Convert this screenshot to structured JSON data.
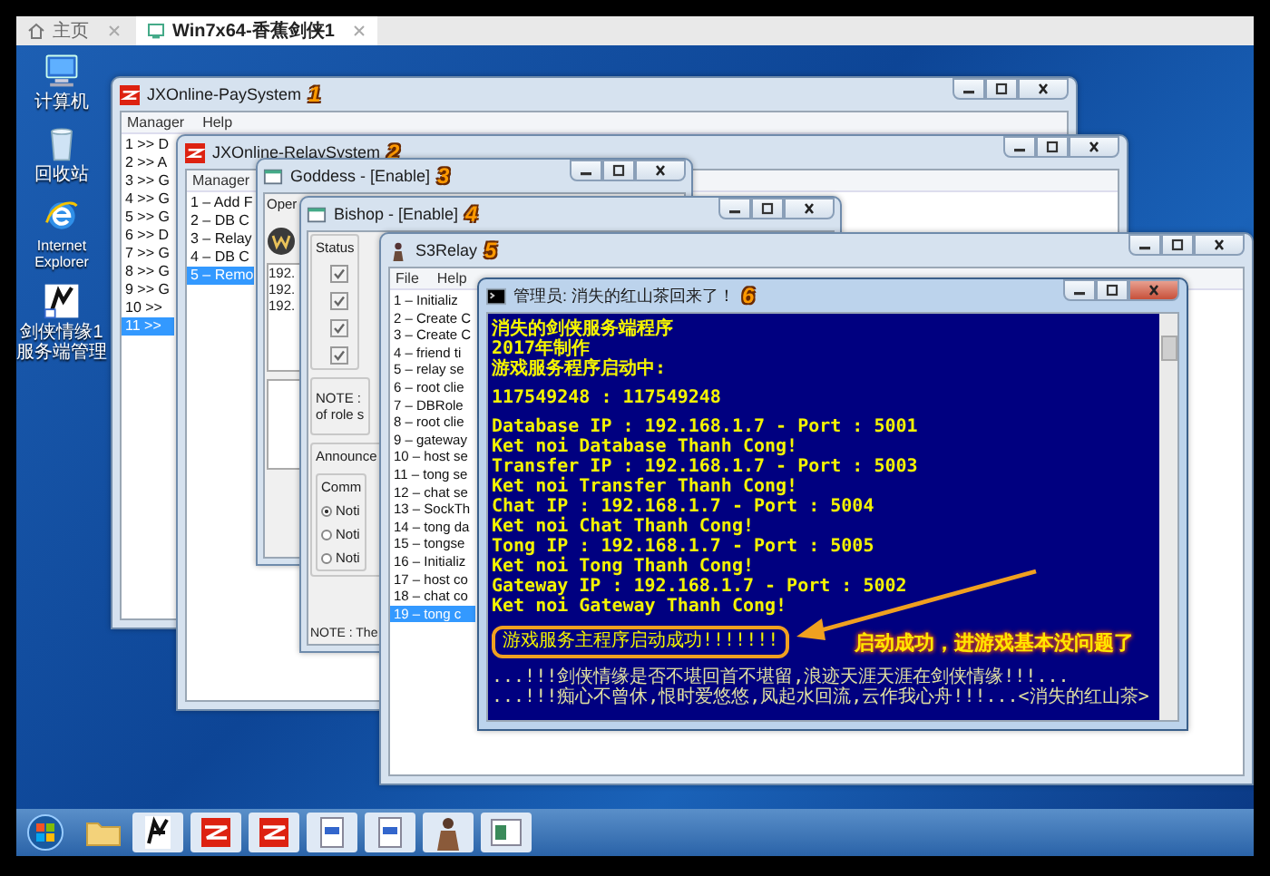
{
  "browser_tabs": [
    {
      "label": "主页",
      "selected": false
    },
    {
      "label": "Win7x64-香蕉剑侠1",
      "selected": true
    }
  ],
  "desktop_icons": [
    {
      "label": "计算机",
      "kind": "computer"
    },
    {
      "label": "回收站",
      "kind": "bin"
    },
    {
      "label": "Internet Explorer",
      "kind": "browser"
    },
    {
      "label": "剑侠情缘1服务端管理",
      "kind": "game"
    }
  ],
  "windows": [
    {
      "kind": "pay",
      "title": "JXOnline-PaySystem",
      "badge": "1",
      "active": false,
      "menu": [
        "Manager",
        "Help"
      ],
      "items": [
        {
          "text": "1 >> D",
          "selected": false
        },
        {
          "text": "2 >> A",
          "selected": false
        },
        {
          "text": "3 >> G",
          "selected": false
        },
        {
          "text": "4 >> G",
          "selected": false
        },
        {
          "text": "5 >> G",
          "selected": false
        },
        {
          "text": "6 >> D",
          "selected": false
        },
        {
          "text": "7 >> G",
          "selected": false
        },
        {
          "text": "8 >> G",
          "selected": false
        },
        {
          "text": "9 >> G",
          "selected": false
        },
        {
          "text": "10 >>",
          "selected": false
        },
        {
          "text": "11 >>",
          "selected": true
        }
      ]
    },
    {
      "kind": "relay",
      "title": "JXOnline-RelaySystem",
      "badge": "2",
      "active": false,
      "menu": [
        "Manager"
      ],
      "items": [
        {
          "text": "1 – Add F",
          "selected": false
        },
        {
          "text": "2 – DB C",
          "selected": false
        },
        {
          "text": "3 – Relay",
          "selected": false
        },
        {
          "text": "4 – DB C",
          "selected": false
        },
        {
          "text": "5 – Remo",
          "selected": true
        }
      ]
    },
    {
      "kind": "goddess",
      "title": "Goddess - [Enable]",
      "badge": "3",
      "active": false,
      "label": "Oper",
      "lines": [
        "192.",
        "192.",
        "192."
      ]
    },
    {
      "kind": "bishop",
      "title": "Bishop - [Enable]",
      "badge": "4",
      "active": false,
      "status_label": "Status",
      "checks": [
        {
          "checked": true
        },
        {
          "checked": true
        },
        {
          "checked": true
        },
        {
          "checked": true
        }
      ],
      "note_lines": [
        "NOTE :",
        "of role s"
      ],
      "group_label": "Announce",
      "subgroup_label": "Comm",
      "radios": [
        {
          "label": "Noti",
          "selected": true
        },
        {
          "label": "Noti",
          "selected": false
        },
        {
          "label": "Noti",
          "selected": false
        }
      ],
      "footer": "NOTE : The"
    },
    {
      "kind": "s3relay",
      "title": "S3Relay",
      "badge": "5",
      "active": false,
      "menu": [
        "File",
        "Help"
      ],
      "items": [
        {
          "text": "1 – Initializ",
          "selected": false
        },
        {
          "text": "2 – Create C",
          "selected": false
        },
        {
          "text": "3 – Create C",
          "selected": false
        },
        {
          "text": "4 – friend ti",
          "selected": false
        },
        {
          "text": "5 – relay se",
          "selected": false
        },
        {
          "text": "6 – root clie",
          "selected": false
        },
        {
          "text": "7 – DBRole",
          "selected": false
        },
        {
          "text": "8 – root clie",
          "selected": false
        },
        {
          "text": "9 – gateway",
          "selected": false
        },
        {
          "text": "10 – host se",
          "selected": false
        },
        {
          "text": "11 – tong se",
          "selected": false
        },
        {
          "text": "12 – chat se",
          "selected": false
        },
        {
          "text": "13 – SockTh",
          "selected": false
        },
        {
          "text": "14 – tong da",
          "selected": false
        },
        {
          "text": "15 – tongse",
          "selected": false
        },
        {
          "text": "16 – Initializ",
          "selected": false
        },
        {
          "text": "17 – host co",
          "selected": false
        },
        {
          "text": "18 – chat co",
          "selected": false
        },
        {
          "text": "19 – tong c",
          "selected": true
        }
      ]
    },
    {
      "kind": "console",
      "title": "管理员: 消失的红山茶回来了！",
      "badge": "6",
      "active": true,
      "blocks": [
        [
          "消失的剑侠服务端程序",
          "2017年制作",
          "游戏服务程序启动中:"
        ],
        [
          "117549248 : 117549248"
        ],
        [
          "Database IP : 192.168.1.7 - Port : 5001",
          "Ket noi Database Thanh Cong!",
          "Transfer IP : 192.168.1.7 - Port : 5003",
          "Ket noi Transfer Thanh Cong!",
          "Chat IP : 192.168.1.7 - Port : 5004",
          "Ket noi Chat Thanh Cong!",
          "Tong IP : 192.168.1.7 - Port : 5005",
          "Ket noi Tong Thanh Cong!",
          "Gateway IP : 192.168.1.7 - Port : 5002",
          "Ket noi Gateway Thanh Cong!"
        ]
      ],
      "highlight": "游戏服务主程序启动成功!!!!!!!",
      "callout": "启动成功，进游戏基本没问题了",
      "tail": [
        "...!!!剑侠情缘是否不堪回首不堪留,浪迹天涯天涯在剑侠情缘!!!...",
        "...!!!痴心不曾休,恨时爱悠悠,凤起水回流,云作我心舟!!!...<消失的红山茶>"
      ]
    }
  ]
}
